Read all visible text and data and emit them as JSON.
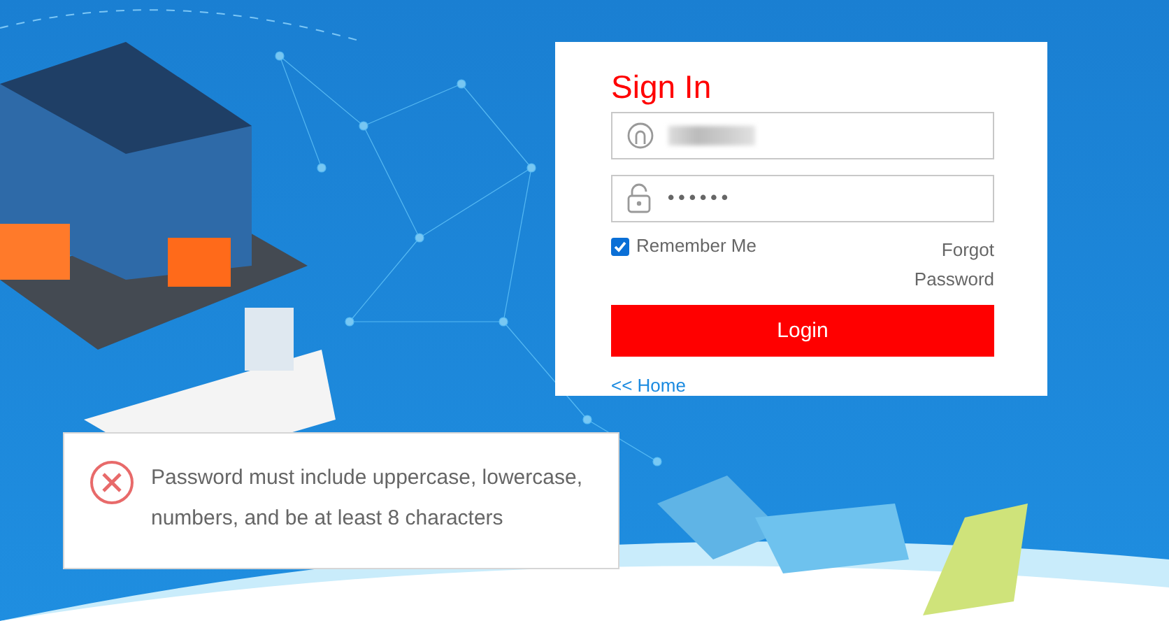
{
  "login": {
    "title": "Sign In",
    "password": {
      "value": "••••••"
    },
    "remember": {
      "label": "Remember Me",
      "checked": true
    },
    "forgot_link": "Forgot Password",
    "login_button": "Login",
    "home_link": "<< Home"
  },
  "toast": {
    "kind": "error",
    "message": "Password must include uppercase, lowercase, numbers, and be at least 8 characters"
  }
}
